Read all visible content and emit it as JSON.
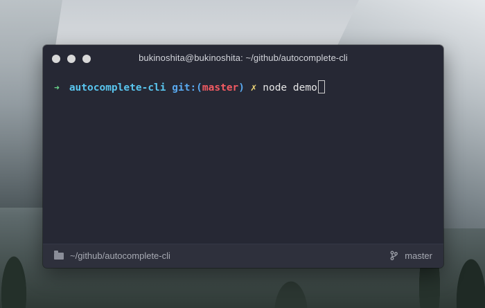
{
  "window": {
    "title": "bukinoshita@bukinoshita: ~/github/autocomplete-cli"
  },
  "terminal": {
    "prompt_arrow": "➜",
    "directory": "autocomplete-cli",
    "git_prefix": "git:(",
    "branch": "master",
    "git_suffix": ")",
    "dirty_mark": "✗",
    "command": "node demo"
  },
  "statusbar": {
    "path": "~/github/autocomplete-cli",
    "branch": "master",
    "folder_icon": "folder-icon",
    "branch_icon": "git-branch-icon"
  },
  "colors": {
    "window_bg": "#262834",
    "statusbar_bg": "#2e303c",
    "arrow": "#6ad48a",
    "directory": "#59c5ee",
    "git": "#59a9f0",
    "branch": "#f25a62",
    "dirty": "#f0d878"
  }
}
